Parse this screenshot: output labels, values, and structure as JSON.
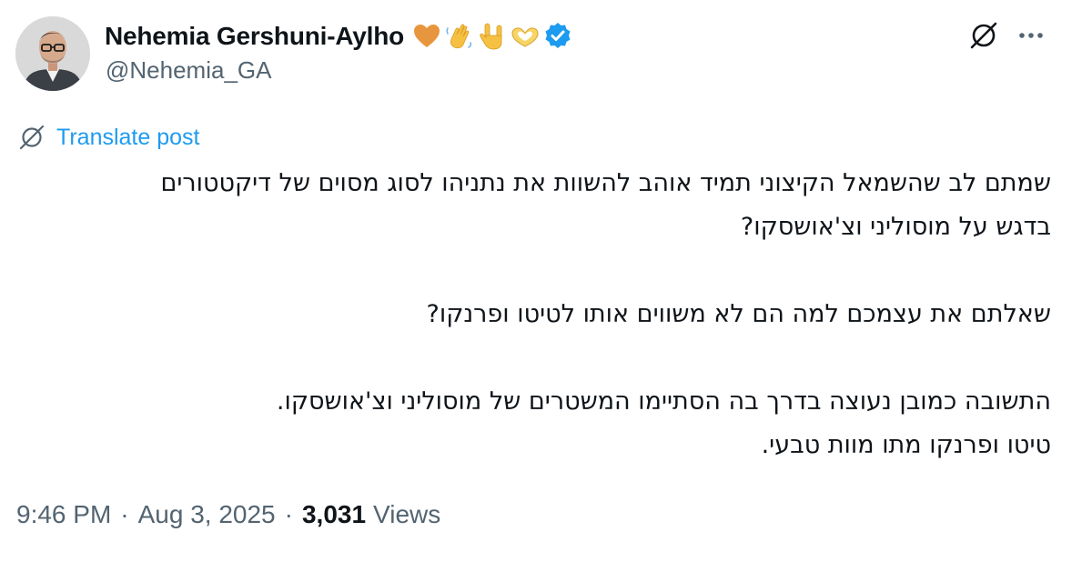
{
  "author": {
    "display_name": "Nehemia Gershuni-Aylho",
    "handle": "@Nehemia_GA",
    "name_emoji_icons": [
      "orange-heart-icon",
      "waving-hand-icon",
      "love-you-hand-icon",
      "heart-hands-icon",
      "verified-badge-icon"
    ],
    "verified_color": "#1d9bf0"
  },
  "header_actions": {
    "grok_icon": "grok-icon",
    "more_icon": "more-options-icon"
  },
  "translate": {
    "label": "Translate post",
    "color": "#1d9bf0"
  },
  "post": {
    "paragraphs": [
      [
        "שמתם לב שהשמאל הקיצוני תמיד אוהב להשוות את נתניהו לסוג מסוים של דיקטטורים",
        "בדגש על מוסוליני וצ'אושסקו?"
      ],
      [
        "שאלתם את עצמכם למה הם לא משווים אותו לטיטו ופרנקו?"
      ],
      [
        "התשובה כמובן נעוצה בדרך בה הסתיימו המשטרים של מוסוליני וצ'אושסקו.",
        "טיטו ופרנקו מתו מוות טבעי."
      ]
    ]
  },
  "meta": {
    "time": "9:46 PM",
    "separator": "·",
    "date": "Aug 3, 2025",
    "views_count": "3,031",
    "views_label": "Views"
  }
}
